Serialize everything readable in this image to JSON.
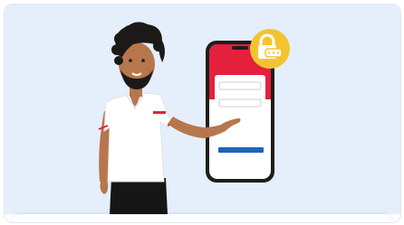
{
  "illustration": {
    "subject": "person-presenting-phone-login",
    "colors": {
      "background": "#e4effb",
      "phone_header": "#e4203c",
      "phone_button": "#1f64b8",
      "lock_badge": "#f4c430",
      "shirt": "#ffffff",
      "shirt_trim": "#e4203c",
      "skin": "#b8764c",
      "hair": "#1c1a18",
      "pants": "#161616"
    },
    "icons": [
      "lock-password-icon"
    ]
  }
}
